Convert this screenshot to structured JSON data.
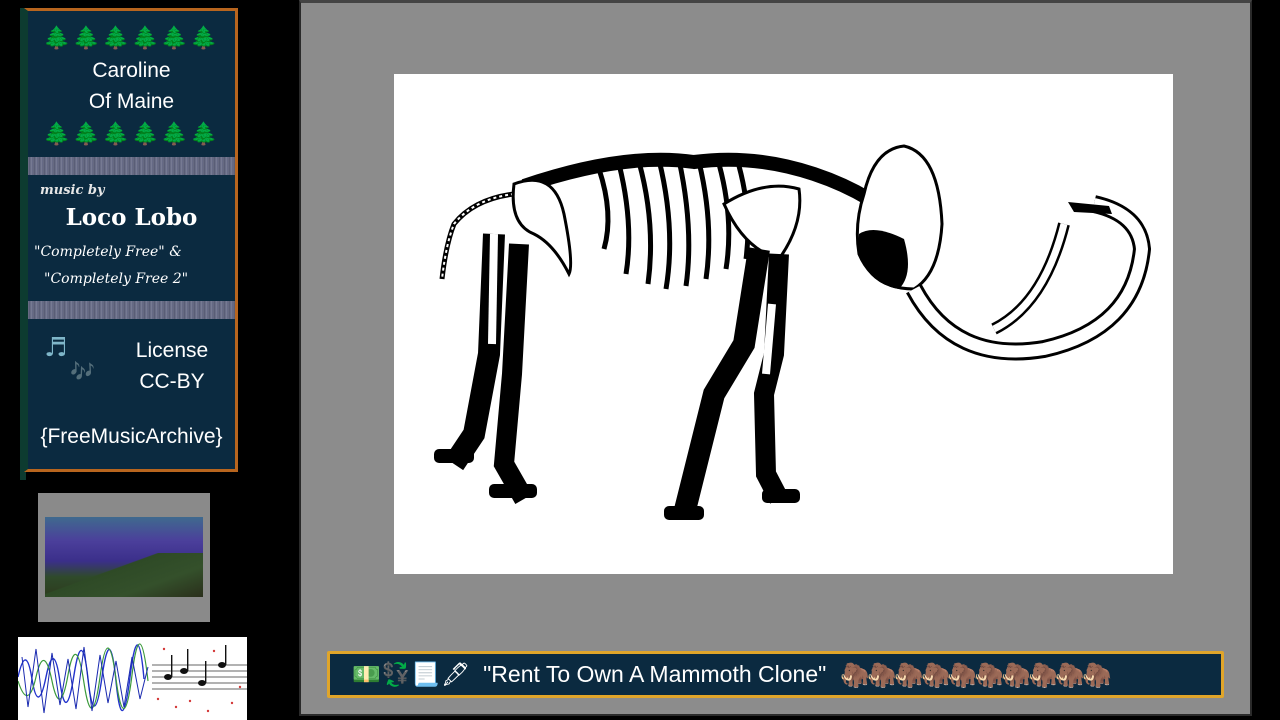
{
  "info_card": {
    "trees": "🌲🌲🌲🌲🌲🌲",
    "song_title_line1": "Caroline",
    "song_title_line2": "Of Maine",
    "music_by": "music by",
    "artist": "Loco Lobo",
    "album_line1": "\"Completely Free\" &",
    "album_line2": "\"Completely Free 2\"",
    "note1": "♬",
    "note2": "🎶",
    "license_line1": "License",
    "license_line2": "CC-BY",
    "source": "{FreeMusicArchive}"
  },
  "caption": {
    "icons": "💵💱📃🖋",
    "title": "\"Rent To Own A Mammoth Clone\"",
    "mammoths": "🦣🦣🦣🦣🦣🦣🦣🦣🦣🦣"
  },
  "colors": {
    "card_bg": "#0b2a40",
    "card_border": "#b8651e",
    "caption_border": "#e0a52a",
    "frame_bg": "#8c8c8c"
  }
}
